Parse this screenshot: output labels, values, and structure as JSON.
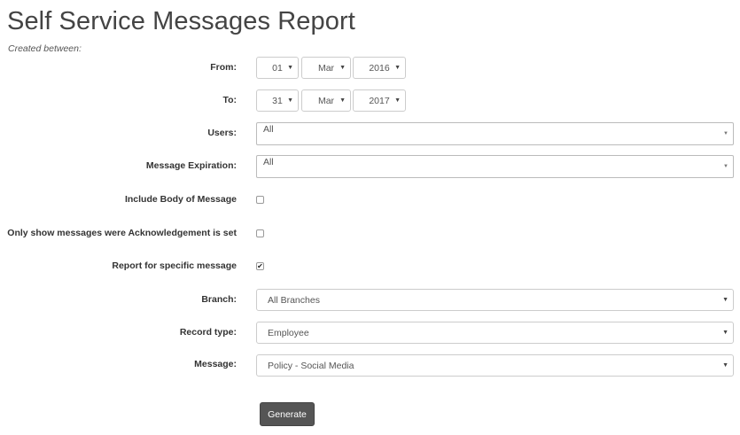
{
  "page": {
    "title": "Self Service Messages Report",
    "subtitle": "Created between:"
  },
  "form": {
    "from": {
      "label": "From:",
      "day": "01",
      "month": "Mar",
      "year": "2016"
    },
    "to": {
      "label": "To:",
      "day": "31",
      "month": "Mar",
      "year": "2017"
    },
    "users": {
      "label": "Users:",
      "value": "All"
    },
    "message_expiration": {
      "label": "Message Expiration:",
      "value": "All"
    },
    "include_body": {
      "label": "Include Body of Message",
      "checked": false
    },
    "only_acknowledged": {
      "label": "Only show messages were Acknowledgement is set",
      "checked": false
    },
    "specific_message": {
      "label": "Report for specific message",
      "checked": true
    },
    "branch": {
      "label": "Branch:",
      "value": "All Branches"
    },
    "record_type": {
      "label": "Record type:",
      "value": "Employee"
    },
    "message": {
      "label": "Message:",
      "value": "Policy - Social Media"
    },
    "generate_label": "Generate"
  },
  "icons": {
    "dropdown_arrow": "▼",
    "checkmark": "✔"
  }
}
